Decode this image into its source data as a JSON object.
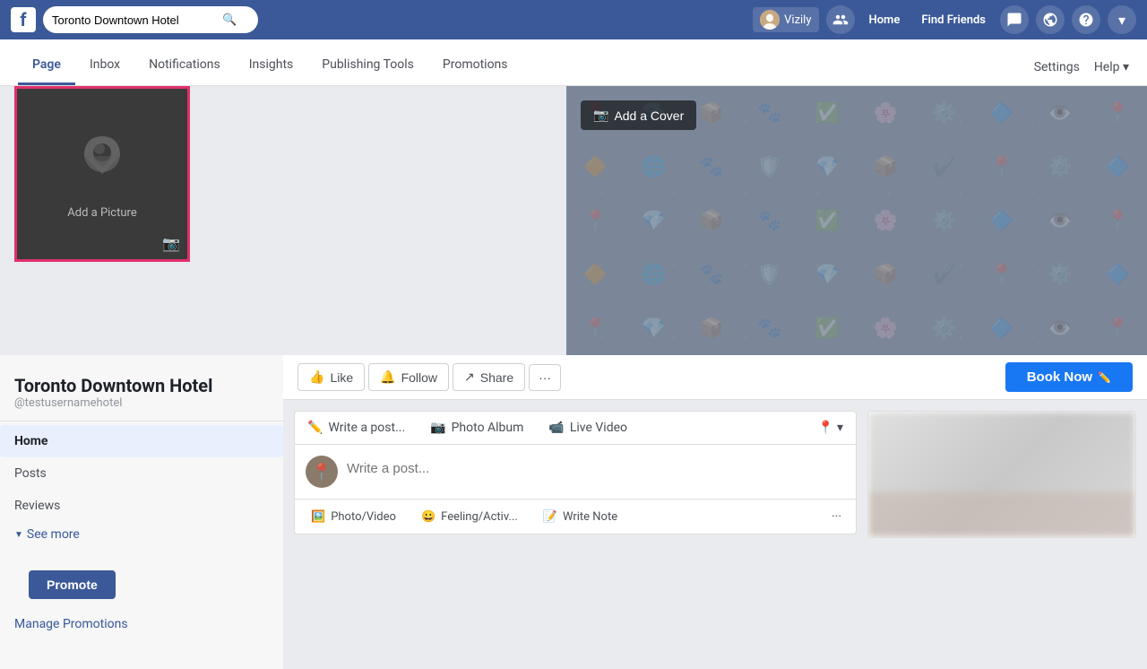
{
  "topnav": {
    "logo": "f",
    "search_placeholder": "Toronto Downtown Hotel",
    "user_name": "Vizily",
    "nav_links": [
      "Home",
      "Find Friends"
    ],
    "icons": [
      "people-icon",
      "messenger-icon",
      "globe-icon",
      "help-icon",
      "dropdown-icon"
    ]
  },
  "pagenav": {
    "items": [
      {
        "label": "Page",
        "active": true
      },
      {
        "label": "Inbox",
        "active": false
      },
      {
        "label": "Notifications",
        "active": false
      },
      {
        "label": "Insights",
        "active": false
      },
      {
        "label": "Publishing Tools",
        "active": false
      },
      {
        "label": "Promotions",
        "active": false
      }
    ],
    "right_items": [
      "Settings",
      "Help"
    ]
  },
  "cover": {
    "add_cover_label": "Add a Cover"
  },
  "profile_pic": {
    "label": "Add a Picture"
  },
  "page_info": {
    "name": "Toronto Downtown Hotel",
    "username": "@testusernamehotel"
  },
  "sidebar_nav": {
    "items": [
      {
        "label": "Home",
        "active": true
      },
      {
        "label": "Posts",
        "active": false
      },
      {
        "label": "Reviews",
        "active": false
      }
    ],
    "see_more": "See more",
    "promote_label": "Promote",
    "manage_promotions": "Manage Promotions"
  },
  "action_bar": {
    "like_label": "Like",
    "follow_label": "Follow",
    "share_label": "Share",
    "book_now_label": "Book Now"
  },
  "post_area": {
    "tabs": [
      {
        "label": "Write a post...",
        "icon": "✏️"
      },
      {
        "label": "Photo Album",
        "icon": "📷"
      },
      {
        "label": "Live Video",
        "icon": "📹"
      }
    ],
    "placeholder": "Write a post...",
    "actions": [
      {
        "label": "Photo/Video",
        "icon": "🖼️"
      },
      {
        "label": "Feeling/Activ...",
        "icon": "😀"
      },
      {
        "label": "Write Note",
        "icon": "📝"
      }
    ]
  }
}
